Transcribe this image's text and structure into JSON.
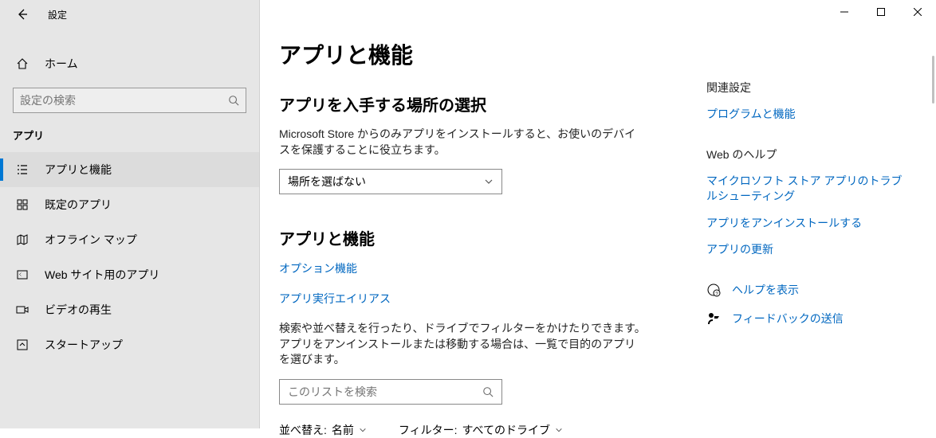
{
  "titlebar": {
    "title": "設定"
  },
  "sidebar": {
    "home_label": "ホーム",
    "search_placeholder": "設定の検索",
    "section_label": "アプリ",
    "items": [
      {
        "label": "アプリと機能"
      },
      {
        "label": "既定のアプリ"
      },
      {
        "label": "オフライン マップ"
      },
      {
        "label": "Web サイト用のアプリ"
      },
      {
        "label": "ビデオの再生"
      },
      {
        "label": "スタートアップ"
      }
    ]
  },
  "main": {
    "heading": "アプリと機能",
    "source_section_title": "アプリを入手する場所の選択",
    "source_desc": "Microsoft Store からのみアプリをインストールすると、お使いのデバイスを保護することに役立ちます。",
    "source_select_value": "場所を選ばない",
    "apps_section_title": "アプリと機能",
    "link_optional": "オプション機能",
    "link_alias": "アプリ実行エイリアス",
    "apps_desc": "検索や並べ替えを行ったり、ドライブでフィルターをかけたりできます。アプリをアンインストールまたは移動する場合は、一覧で目的のアプリを選びます。",
    "list_search_placeholder": "このリストを検索",
    "sort_label": "並べ替え:",
    "sort_value": "名前",
    "filter_label": "フィルター:",
    "filter_value": "すべてのドライブ"
  },
  "right": {
    "related_title": "関連設定",
    "related_link": "プログラムと機能",
    "webhelp_title": "Web のヘルプ",
    "webhelp_links": [
      "マイクロソフト ストア アプリのトラブルシューティング",
      "アプリをアンインストールする",
      "アプリの更新"
    ],
    "help_label": "ヘルプを表示",
    "feedback_label": "フィードバックの送信"
  }
}
